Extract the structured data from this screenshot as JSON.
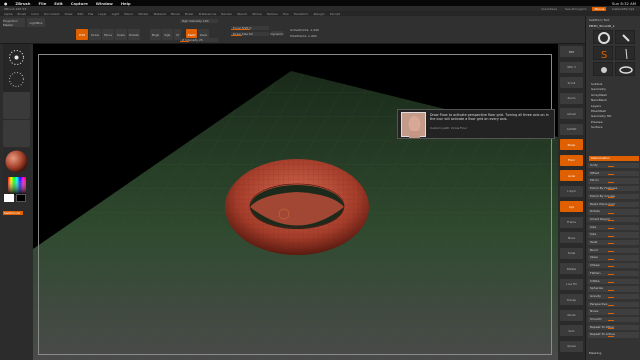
{
  "mac_menubar": {
    "app": "ZBrush",
    "items": [
      "File",
      "Edit",
      "Capture",
      "Window",
      "Help"
    ],
    "clock": "Sun 8:32 AM"
  },
  "zbrush_strip": {
    "info": "ZBrush 4R7 P3",
    "menus": [
      {
        "label": "QuickSave",
        "active": false
      },
      {
        "label": "See-through 0",
        "active": false
      },
      {
        "label": "Menus",
        "active": true
      },
      {
        "label": "DefaultZScript",
        "active": false
      }
    ]
  },
  "zbrush_menu": [
    "Alpha",
    "Brush",
    "Color",
    "Document",
    "Draw",
    "Edit",
    "File",
    "Layer",
    "Light",
    "Macro",
    "Marker",
    "Material",
    "Movie",
    "Picker",
    "Preferences",
    "Render",
    "Stencil",
    "Stroke",
    "Texture",
    "Tool",
    "Transform",
    "Zplugin",
    "Zscript"
  ],
  "toolbar": {
    "projection_master": "Projection Master",
    "lightbox": "LightBox",
    "edit": "Edit",
    "draw": "Draw",
    "move": "Move",
    "scale": "Scale",
    "rotate": "Rotate",
    "mrgb": "Mrgb",
    "rgb": "Rgb",
    "m": "M",
    "zadd": "Zadd",
    "zsub": "Zsub",
    "focal_shift": "Focal Shift 0",
    "draw_size": "Draw Size 64",
    "rgb_intensity": "Rgb Intensity 100",
    "z_intensity": "Z Intensity 25",
    "active_points": "ActivePoints: 1,440",
    "total_points": "TotalPoints: 1,440",
    "dynamic": "Dynamic"
  },
  "left_shelf": {
    "standard": "Standard",
    "dots": "Dots",
    "alpha_off": "Alpha Off",
    "texture_off": "Texture Off",
    "material": "MatCap Red Wax",
    "gradient": "Gradient",
    "switch_color": "SwitchColor",
    "alternate": "Alternate"
  },
  "tooltip": {
    "text": "Draw Floor to activate perspective floor grid. Turning all three axis on in the icon will activate a floor grid on every axis.",
    "shortcut": "Custom path: Draw:Floor"
  },
  "right_rail": [
    {
      "label": "BPR",
      "active": false
    },
    {
      "label": "SPix 3",
      "active": false
    },
    {
      "label": "Scroll",
      "active": false
    },
    {
      "label": "Zoom",
      "active": false
    },
    {
      "label": "Actual",
      "active": false
    },
    {
      "label": "AAHalf",
      "active": false
    },
    {
      "label": "Persp",
      "active": true
    },
    {
      "label": "Floor",
      "active": true
    },
    {
      "label": "Local",
      "active": true
    },
    {
      "label": "L.Sym",
      "active": false
    },
    {
      "label": "Xyz",
      "active": true
    },
    {
      "label": "Frame",
      "active": false
    },
    {
      "label": "Move",
      "active": false
    },
    {
      "label": "Scale",
      "active": false
    },
    {
      "label": "Rotate",
      "active": false
    },
    {
      "label": "Line Fill",
      "active": false
    },
    {
      "label": "Transp",
      "active": false
    },
    {
      "label": "Ghost",
      "active": false
    },
    {
      "label": "Solo",
      "active": false
    },
    {
      "label": "Xpose",
      "active": false
    }
  ],
  "tray": {
    "title": "SubTool | Tool",
    "tool_name": "PM3D_Torus3D_1",
    "brush_labels": [
      "Torus3D",
      "SimpleBrush",
      "PM3D_Torus3D",
      "Cylinder3D",
      "PolyMesh3D",
      "PM3D_Torus3D_1"
    ],
    "sections": [
      "Subtool",
      "Geometry",
      "ArrayMesh",
      "NanoMesh",
      "Layers",
      "FiberMesh",
      "Geometry HD",
      "Preview",
      "Surface",
      "Deformation"
    ],
    "deformation_props": [
      "Unify",
      "Offset",
      "Mirror",
      "Polish By Features",
      "Polish By Groups",
      "Relax Plane Grid",
      "Rotate",
      "Smart Resym",
      "Size",
      "Size",
      "Twist",
      "Bend",
      "Skew",
      "SSkew",
      "Flatten",
      "Inflate",
      "Spherize",
      "Gravity",
      "Perspective",
      "Noise",
      "Smooth",
      "Repeat To Other",
      "Repeat To Active"
    ],
    "masking": "Masking"
  },
  "canvas": {
    "floor_color": "#3c5a3c",
    "torus_color": "#b84a3a"
  }
}
